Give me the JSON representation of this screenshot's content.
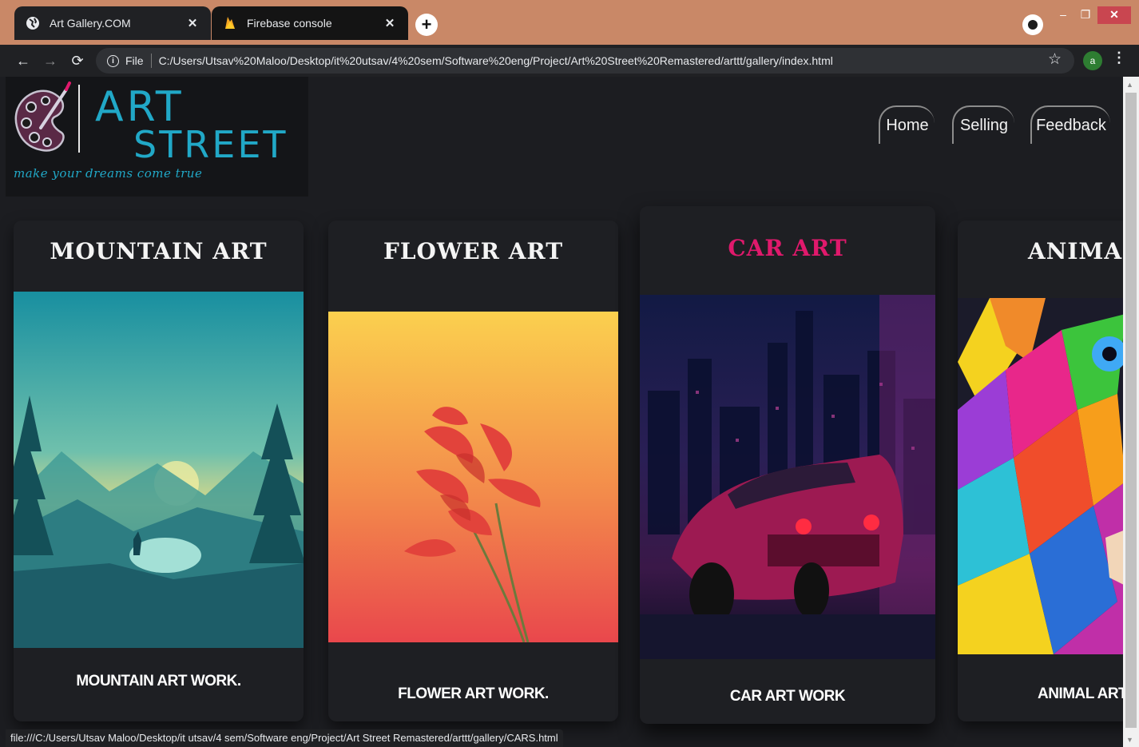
{
  "browser": {
    "tabs": [
      {
        "title": "Art Gallery.COM",
        "favicon": "globe-icon",
        "active": true
      },
      {
        "title": "Firebase console",
        "favicon": "firebase-flame-icon",
        "active": false
      }
    ],
    "new_tab_label": "+",
    "address": {
      "scheme_label": "File",
      "url": "C:/Users/Utsav%20Maloo/Desktop/it%20utsav/4%20sem/Software%20eng/Project/Art%20Street%20Remastered/arttt/gallery/index.html"
    },
    "profile_initial": "a",
    "status_url": "file:///C:/Users/Utsav Maloo/Desktop/it utsav/4 sem/Software eng/Project/Art Street Remastered/arttt/gallery/CARS.html"
  },
  "site": {
    "logo": {
      "line1": "ART",
      "line2": "STREET",
      "tagline": "make your dreams come true"
    },
    "nav": [
      {
        "label": "Home"
      },
      {
        "label": "Selling"
      },
      {
        "label": "Feedback"
      }
    ],
    "cards": [
      {
        "title": "MOUNTAIN ART",
        "description": "MOUNTAIN ART WORK.",
        "image": "mountain-landscape"
      },
      {
        "title": "FLOWER ART",
        "description": "FLOWER ART WORK.",
        "image": "red-flower"
      },
      {
        "title": "CAR ART",
        "description": "CAR ART WORK",
        "image": "neon-sports-car",
        "highlighted": true
      },
      {
        "title": "ANIMAL ART",
        "description": "ANIMAL ART WORK.",
        "image": "colorful-lion"
      }
    ]
  },
  "colors": {
    "page_background": "#1c1d21",
    "card_background": "#1e1f23",
    "highlight_title": "#e0196c",
    "logo_cyan": "#21a8c7",
    "browser_frame": "#c98867"
  }
}
